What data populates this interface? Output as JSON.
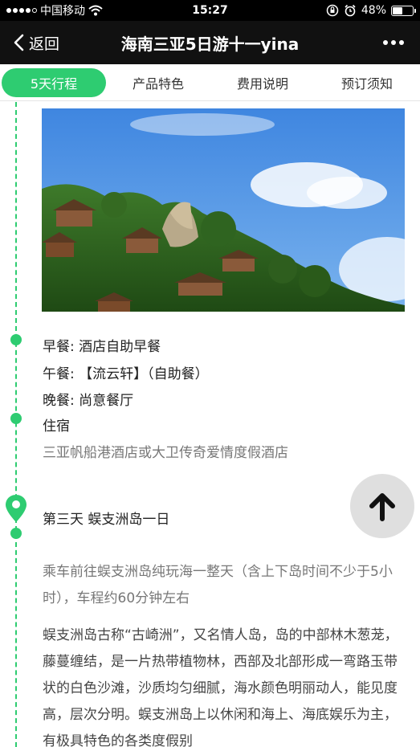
{
  "status_bar": {
    "carrier": "中国移动",
    "time": "15:27",
    "battery_percent": "48%",
    "battery_level": 0.48,
    "signal_icon": "signal-dots-icon",
    "wifi_icon": "wifi-icon",
    "lock_icon": "orientation-lock-icon",
    "alarm_icon": "alarm-icon"
  },
  "nav": {
    "back_label": "返回",
    "title": "海南三亚5日游十一yina",
    "more_icon": "more-dots-icon"
  },
  "tabs": [
    {
      "label": "5天行程",
      "active": true
    },
    {
      "label": "产品特色",
      "active": false
    },
    {
      "label": "费用说明",
      "active": false
    },
    {
      "label": "预订须知",
      "active": false
    }
  ],
  "colors": {
    "accent": "#2ecc71",
    "nav_bg": "#111111",
    "text_muted": "#777777"
  },
  "itinerary": {
    "photo_icon": "island-photo",
    "meals": {
      "breakfast": "早餐: 酒店自助早餐",
      "lunch": "午餐: 【流云轩】（自助餐）",
      "dinner": "晚餐: 尚意餐厅"
    },
    "lodging_label": "住宿",
    "lodging_value": "三亚帆船港酒店或大卫传奇爱情度假酒店",
    "day3_title": "第三天 蜈支洲岛一日",
    "day3_intro": "乘车前往蜈支洲岛纯玩海一整天（含上下岛时间不少于5小时），车程约60分钟左右",
    "day3_desc": "蜈支洲岛古称“古崎洲”，又名情人岛，岛的中部林木葱茏，藤蔓缠结，是一片热带植物林，西部及北部形成一弯路玉带状的白色沙滩，沙质均匀细腻，海水颜色明丽动人，能见度高，层次分明。蜈支洲岛上以休闲和海上、海底娱乐为主，有极具特色的各类度假别"
  },
  "scroll_top_icon": "arrow-up-icon"
}
